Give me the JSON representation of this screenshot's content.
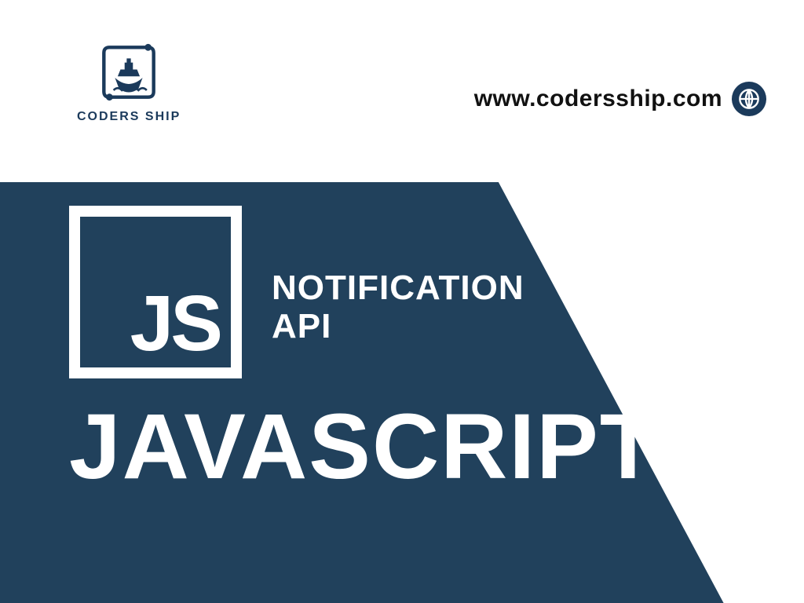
{
  "brand": {
    "logo_label": "CODERS SHIP",
    "accent_color": "#1b3a5b"
  },
  "url": {
    "text": "www.codersship.com"
  },
  "card": {
    "bg_color": "#21415c",
    "badge_letters": "JS",
    "api_line1": "NOTIFICATION",
    "api_line2": "API",
    "main_title": "JAVASCRIPT"
  }
}
